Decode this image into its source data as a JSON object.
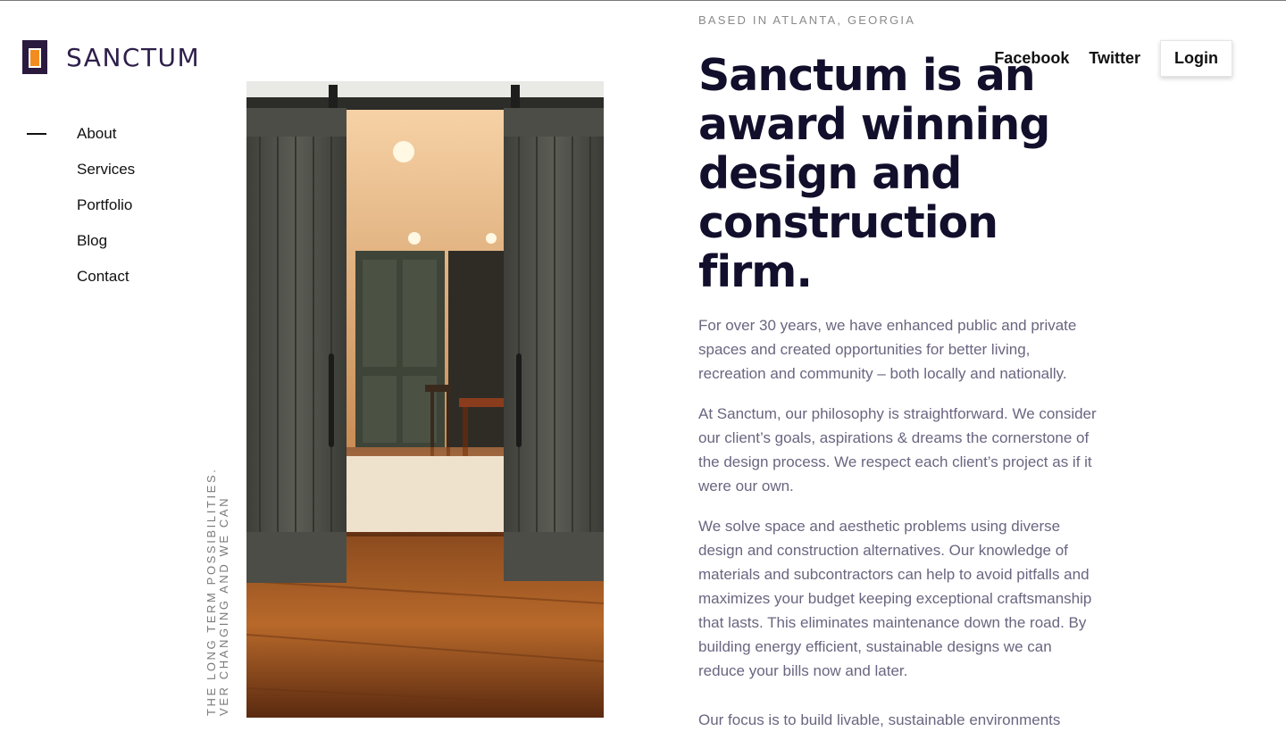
{
  "brand": {
    "name": "SANCTUM",
    "colors": {
      "mark": "#2a1a3e",
      "accent": "#f28c1e",
      "headline": "#120f2c",
      "body": "#6b6580"
    }
  },
  "sidebar": {
    "items": [
      {
        "label": "About",
        "active": true
      },
      {
        "label": "Services"
      },
      {
        "label": "Portfolio"
      },
      {
        "label": "Blog"
      },
      {
        "label": "Contact"
      }
    ]
  },
  "tagline": {
    "line1": "VER CHANGING AND WE CAN",
    "line2": "THE LONG TERM POSSIBILITIES."
  },
  "header": {
    "links": {
      "facebook": "Facebook",
      "twitter": "Twitter"
    },
    "login_label": "Login"
  },
  "hero": {
    "eyebrow": "BASED IN ATLANTA, GEORGIA",
    "headline": "Sanctum is an award winning design and construction firm."
  },
  "body": {
    "paragraphs": [
      "For over 30 years, we have enhanced public and private spaces and created opportunities for better living, recreation and community – both locally and nationally.",
      "At Sanctum, our philosophy is straightforward. We consider our client’s goals, aspirations & dreams the cornerstone of the design process. We respect each client’s project as if it were our own.",
      "We solve space and aesthetic problems using diverse design and construction alternatives. Our knowledge of materials and subcontractors can help to avoid pitfalls and maximizes your budget keeping exceptional craftsmanship that lasts. This eliminates maintenance down the road. By building energy efficient, sustainable designs we can reduce your bills now and later.",
      "Our focus is to build livable, sustainable environments"
    ]
  },
  "photo": {
    "icon": "barn-door-interior-photo"
  }
}
